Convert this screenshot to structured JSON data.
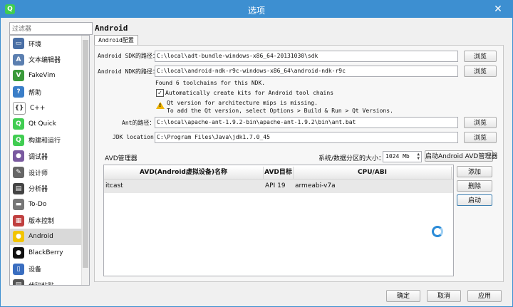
{
  "window": {
    "title": "选项",
    "close_glyph": "✕",
    "app_icon_letter": "Q"
  },
  "filter": {
    "placeholder": "过滤器"
  },
  "sidebar": {
    "items": [
      {
        "label": "环境",
        "icon": "monitor-icon",
        "color": "#4a6fa5",
        "glyph": "▭"
      },
      {
        "label": "文本编辑器",
        "icon": "text-editor-icon",
        "color": "#5b7fb0",
        "glyph": "A"
      },
      {
        "label": "FakeVim",
        "icon": "fakevim-icon",
        "color": "#3a9a3a",
        "glyph": "V"
      },
      {
        "label": "帮助",
        "icon": "help-icon",
        "color": "#3a7ec8",
        "glyph": "?"
      },
      {
        "label": "C++",
        "icon": "cpp-icon",
        "color": "#ffffff",
        "glyph": "{}"
      },
      {
        "label": "Qt Quick",
        "icon": "qt-quick-icon",
        "color": "#41cd52",
        "glyph": "Q"
      },
      {
        "label": "构建和运行",
        "icon": "build-run-icon",
        "color": "#41cd52",
        "glyph": "Q"
      },
      {
        "label": "调试器",
        "icon": "debugger-icon",
        "color": "#7a5aa0",
        "glyph": "●"
      },
      {
        "label": "设计师",
        "icon": "designer-icon",
        "color": "#666666",
        "glyph": "✎"
      },
      {
        "label": "分析器",
        "icon": "analyzer-icon",
        "color": "#444444",
        "glyph": "▤"
      },
      {
        "label": "To-Do",
        "icon": "todo-icon",
        "color": "#777777",
        "glyph": "▬"
      },
      {
        "label": "版本控制",
        "icon": "version-control-icon",
        "color": "#c04040",
        "glyph": "▦"
      },
      {
        "label": "Android",
        "icon": "android-icon",
        "color": "#f2c400",
        "glyph": "●"
      },
      {
        "label": "BlackBerry",
        "icon": "blackberry-icon",
        "color": "#111111",
        "glyph": "●"
      },
      {
        "label": "设备",
        "icon": "devices-icon",
        "color": "#3a6ec0",
        "glyph": "▯"
      },
      {
        "label": "代码粘贴",
        "icon": "code-paste-icon",
        "color": "#555555",
        "glyph": "▤"
      }
    ],
    "active_index": 12
  },
  "pane": {
    "title": "Android",
    "tab_label": "Android配置"
  },
  "config": {
    "sdk_label": "Android SDK的路径：",
    "sdk_value": "C:\\local\\adt-bundle-windows-x86_64-20131030\\sdk",
    "ndk_label": "Android NDK的路径：",
    "ndk_value": "C:\\local\\android-ndk-r9c-windows-x86_64\\android-ndk-r9c",
    "found_text": "Found 6 toolchains for this NDK.",
    "auto_kits_label": "Automatically create kits for Android tool chains",
    "auto_kits_checked": "✓",
    "warning_line1": "Qt version for architecture mips is missing.",
    "warning_line2": "To add the Qt version, select Options > Build & Run > Qt Versions.",
    "ant_label": "Ant的路径：",
    "ant_value": "C:\\local\\apache-ant-1.9.2-bin\\apache-ant-1.9.2\\bin\\ant.bat",
    "jdk_label": "JDK location:",
    "jdk_value": "C:\\Program Files\\Java\\jdk1.7.0_45",
    "browse_label": "浏览"
  },
  "avd": {
    "section_label": "AVD管理器",
    "partition_label": "系统/数据分区的大小：",
    "partition_value": "1024 Mb",
    "start_manager_label": "启动Android AVD管理器",
    "columns": [
      "AVD(Android虚拟设备)名称",
      "AVD目标",
      "CPU/ABI"
    ],
    "rows": [
      {
        "name": "itcast",
        "target": "API 19",
        "abi": "armeabi-v7a"
      }
    ],
    "add_label": "添加",
    "delete_label": "删除",
    "start_label": "启动"
  },
  "footer": {
    "ok_label": "确定",
    "cancel_label": "取消",
    "apply_label": "应用"
  }
}
